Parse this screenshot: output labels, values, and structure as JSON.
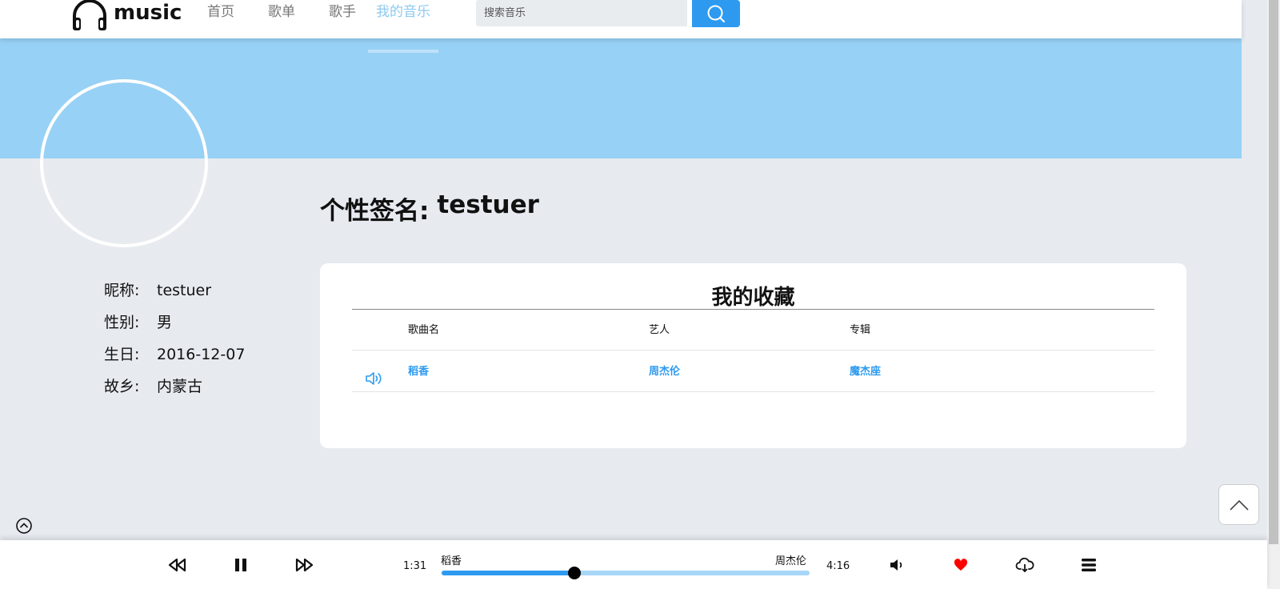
{
  "header": {
    "logo_text": "music",
    "nav": [
      {
        "label": "首页"
      },
      {
        "label": "歌单"
      },
      {
        "label": "歌手"
      },
      {
        "label": "我的音乐",
        "active": true
      }
    ],
    "search": {
      "placeholder": "搜索音乐",
      "value": ""
    }
  },
  "profile": {
    "signature_label": "个性签名:",
    "signature_value": "testuer",
    "fields": [
      {
        "key": "昵称:",
        "value": "testuer"
      },
      {
        "key": "性别:",
        "value": "男"
      },
      {
        "key": "生日:",
        "value": "2016-12-07"
      },
      {
        "key": "故乡:",
        "value": "内蒙古"
      }
    ]
  },
  "favorites": {
    "title": "我的收藏",
    "columns": [
      "歌曲名",
      "艺人",
      "专辑"
    ],
    "rows": [
      {
        "song": "稻香",
        "artist": "周杰伦",
        "album": "魔杰座",
        "icon": "speaker-icon"
      }
    ]
  },
  "player": {
    "current_time": "1:31",
    "duration": "4:16",
    "song_title": "稻香",
    "artist": "周杰伦",
    "progress": 0.36
  },
  "colors": {
    "accent": "#2d9af0",
    "banner": "#97d1f5",
    "nav_active": "#8dc9ef",
    "background": "#e7ebf0",
    "heart": "#f00"
  }
}
